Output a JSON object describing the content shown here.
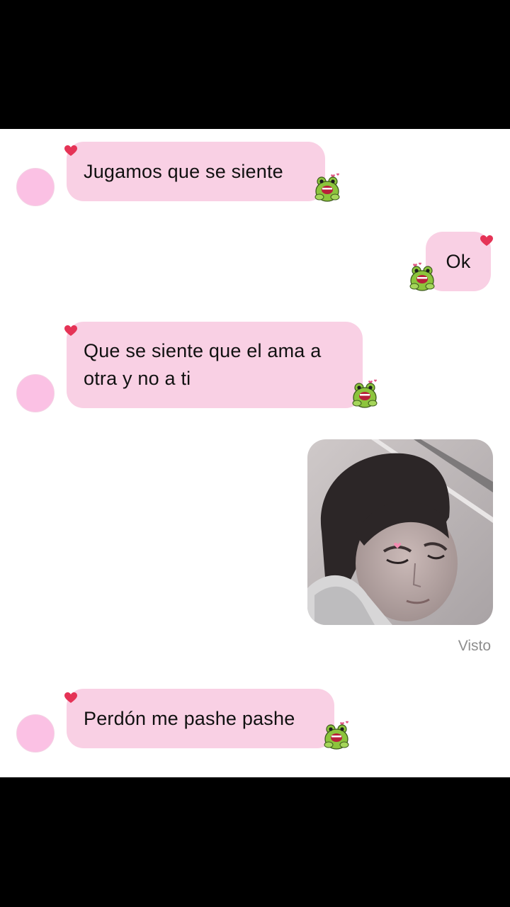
{
  "messages": [
    {
      "side": "received",
      "text": "Jugamos que se siente"
    },
    {
      "side": "sent",
      "text": "Ok"
    },
    {
      "side": "received",
      "text_lines": [
        "Que se siente que el ama a",
        "otra y no a ti"
      ]
    },
    {
      "side": "sent",
      "type": "photo"
    },
    {
      "side": "received",
      "text": "Perdón me pashe pashe"
    }
  ],
  "status": {
    "seen": "Visto"
  },
  "icons": {
    "reaction": "heart-icon",
    "sticker": "frog-sticker-icon"
  },
  "colors": {
    "bubble": "#f9d0e4",
    "avatar": "#fbc1e4",
    "heart": "#e53356",
    "frog": "#8cc43c"
  }
}
